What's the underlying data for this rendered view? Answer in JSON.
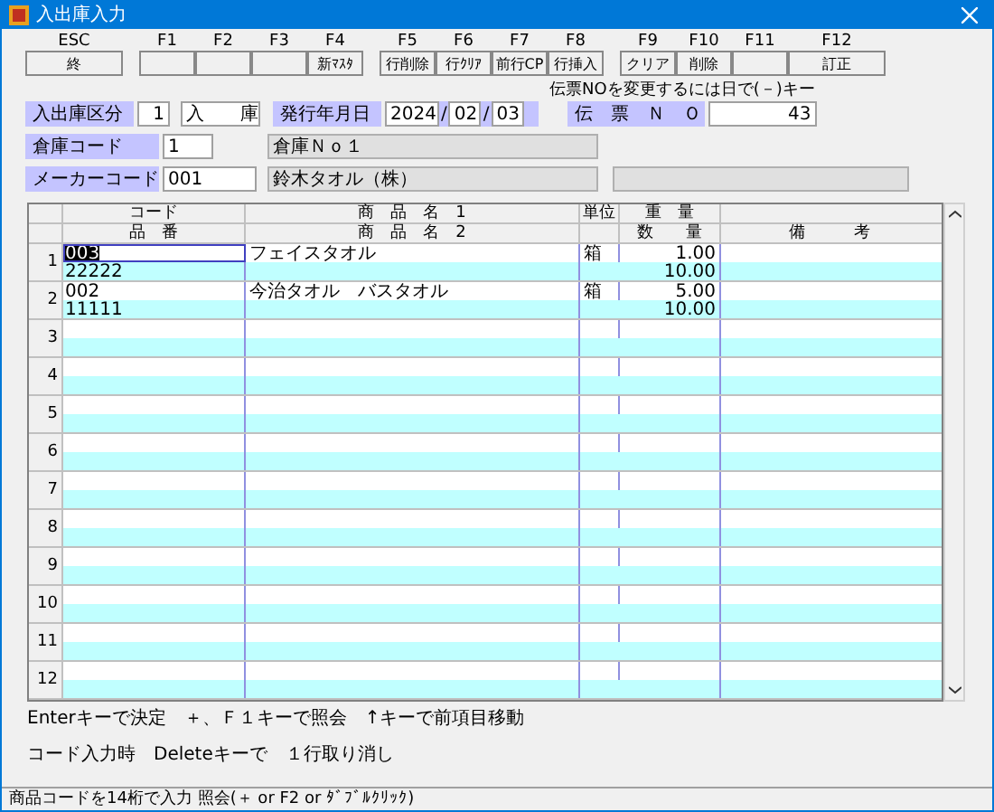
{
  "window": {
    "title": "入出庫入力"
  },
  "function_keys": [
    [
      {
        "key": "ESC",
        "label": "終"
      }
    ],
    [
      {
        "key": "F1"
      },
      {
        "key": "F2"
      },
      {
        "key": "F3"
      },
      {
        "key": "F4",
        "label": "新ﾏｽﾀ"
      }
    ],
    [
      {
        "key": "F5",
        "label": "行削除"
      },
      {
        "key": "F6",
        "label": "行ｸﾘｱ"
      },
      {
        "key": "F7",
        "label": "前行CP"
      },
      {
        "key": "F8",
        "label": "行挿入"
      }
    ],
    [
      {
        "key": "F9",
        "label": "クリア"
      },
      {
        "key": "F10",
        "label": "削除"
      },
      {
        "key": "F11"
      },
      {
        "key": "F12",
        "label": "訂正"
      }
    ]
  ],
  "hint": "伝票NOを変更するには日で(－)キー",
  "header": {
    "type_label": "入出庫区分",
    "type_code": "1",
    "type_name": "入　　庫",
    "date_label": "発行年月日",
    "year": "2024",
    "separator_1": "/",
    "month": "02",
    "separator_2": "/",
    "day": "03",
    "slip_label": "伝　票　Ｎ　Ｏ",
    "slip_no": "43",
    "warehouse_label": "倉庫コード",
    "warehouse_code": "1",
    "warehouse_name": "倉庫Ｎｏ１",
    "maker_label": "メーカーコード",
    "maker_code": "001",
    "maker_name": "鈴木タオル（株）"
  },
  "table": {
    "header_top": {
      "code": "コード",
      "name": "商　品　名　1",
      "unit": "単位",
      "weight": "重　量"
    },
    "header_bottom": {
      "code": "品　番",
      "name": "商　品　名　2",
      "weight": "数　　量",
      "remarks": "備　　　考"
    },
    "rows": [
      {
        "number": "1",
        "code": "003",
        "name": "フェイスタオル",
        "unit": "箱",
        "weight": "1.00",
        "part_no": "22222",
        "quantity": "10.00",
        "selected": true
      },
      {
        "number": "2",
        "code": "002",
        "name": "今治タオル　バスタオル",
        "unit": "箱",
        "weight": "5.00",
        "part_no": "11111",
        "quantity": "10.00",
        "selected": false
      },
      {
        "number": "3",
        "selected": false
      },
      {
        "number": "4",
        "selected": false
      },
      {
        "number": "5",
        "selected": false
      },
      {
        "number": "6",
        "selected": false
      },
      {
        "number": "7",
        "selected": false
      },
      {
        "number": "8",
        "selected": false
      },
      {
        "number": "9",
        "selected": false
      },
      {
        "number": "10",
        "selected": false
      },
      {
        "number": "11",
        "selected": false
      },
      {
        "number": "12",
        "selected": false
      }
    ]
  },
  "help_lines": [
    "Enterキーで決定　＋、Ｆ１キーで照会　↑キーで前項目移動",
    "コード入力時　Deleteキーで　１行取り消し"
  ],
  "status_bar": "商品コードを14桁で入力 照会(＋ or F2 or ﾀﾞﾌﾞﾙｸﾘｯｸ)"
}
